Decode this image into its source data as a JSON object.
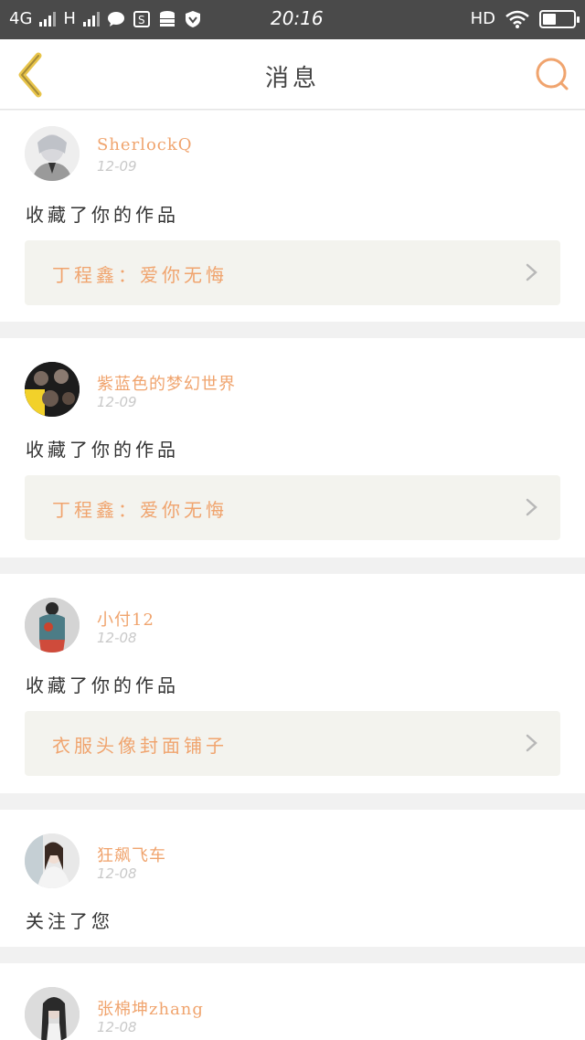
{
  "status_bar": {
    "network_left": "4G",
    "network_mid": "H",
    "time": "20:16",
    "hd": "HD",
    "battery_level": 0.45
  },
  "header": {
    "title": "消息",
    "back_icon": "chevron-left-icon",
    "search_icon": "search-icon",
    "accent_color": "#f0a46e"
  },
  "messages": [
    {
      "name": "SherlockQ",
      "date": "12-09",
      "action": "收藏了你的作品",
      "work": "丁程鑫：爱你无悔"
    },
    {
      "name": "紫蓝色的梦幻世界",
      "date": "12-09",
      "action": "收藏了你的作品",
      "work": "丁程鑫：爱你无悔"
    },
    {
      "name": "小付12",
      "date": "12-08",
      "action": "收藏了你的作品",
      "work": "衣服头像封面铺子"
    },
    {
      "name": "狂飙飞车",
      "date": "12-08",
      "action": "关注了您"
    },
    {
      "name": "张棉坤zhang",
      "date": "12-08"
    }
  ]
}
